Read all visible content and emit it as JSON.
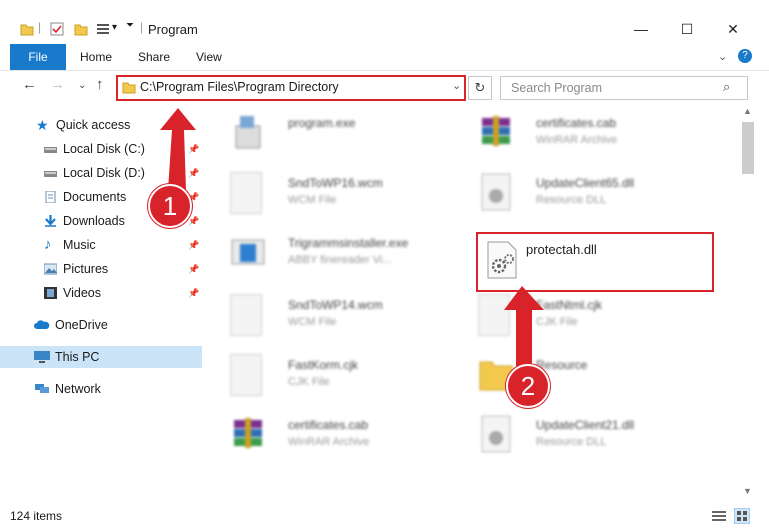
{
  "window": {
    "title": "Program"
  },
  "ribbon": {
    "tabs": [
      "File",
      "Home",
      "Share",
      "View"
    ]
  },
  "address": {
    "path": "C:\\Program Files\\Program Directory"
  },
  "search": {
    "placeholder": "Search Program"
  },
  "nav": {
    "quick_access": "Quick access",
    "items": [
      {
        "label": "Local Disk (C:)",
        "icon": "drive-icon"
      },
      {
        "label": "Local Disk (D:)",
        "icon": "drive-icon"
      },
      {
        "label": "Documents",
        "icon": "documents-icon"
      },
      {
        "label": "Downloads",
        "icon": "downloads-icon"
      },
      {
        "label": "Music",
        "icon": "music-icon"
      },
      {
        "label": "Pictures",
        "icon": "pictures-icon"
      },
      {
        "label": "Videos",
        "icon": "videos-icon"
      }
    ],
    "onedrive": "OneDrive",
    "this_pc": "This PC",
    "network": "Network"
  },
  "files": [
    {
      "name": "program.exe",
      "type": "",
      "icon": "installer-icon"
    },
    {
      "name": "certificates.cab",
      "type": "WinRAR Archive",
      "icon": "winrar-icon"
    },
    {
      "name": "SndToWP16.wcm",
      "type": "WCM File",
      "icon": "file-icon"
    },
    {
      "name": "UpdateClient65.dll",
      "type": "Resource DLL",
      "icon": "dll-icon"
    },
    {
      "name": "Trigrammsinstaller.exe",
      "type": "ABBY finereader Vi...",
      "icon": "exe-icon"
    },
    {
      "name": "protectah.dll",
      "type": "",
      "icon": "dll-icon"
    },
    {
      "name": "SndToWP14.wcm",
      "type": "WCM File",
      "icon": "file-icon"
    },
    {
      "name": "FastNtml.cjk",
      "type": "CJK File",
      "icon": "file-icon"
    },
    {
      "name": "FastKorm.cjk",
      "type": "CJK File",
      "icon": "file-icon"
    },
    {
      "name": "Resource",
      "type": "",
      "icon": "folder-icon"
    },
    {
      "name": "certificates.cab",
      "type": "WinRAR Archive",
      "icon": "winrar-icon"
    },
    {
      "name": "UpdateClient21.dll",
      "type": "Resource DLL",
      "icon": "dll-icon"
    }
  ],
  "status": {
    "count": "124 items"
  },
  "annotations": {
    "step1": "1",
    "step2": "2"
  },
  "colors": {
    "accent": "#1979ca",
    "highlight": "#d9232b",
    "selected_nav": "#cce4f7"
  }
}
